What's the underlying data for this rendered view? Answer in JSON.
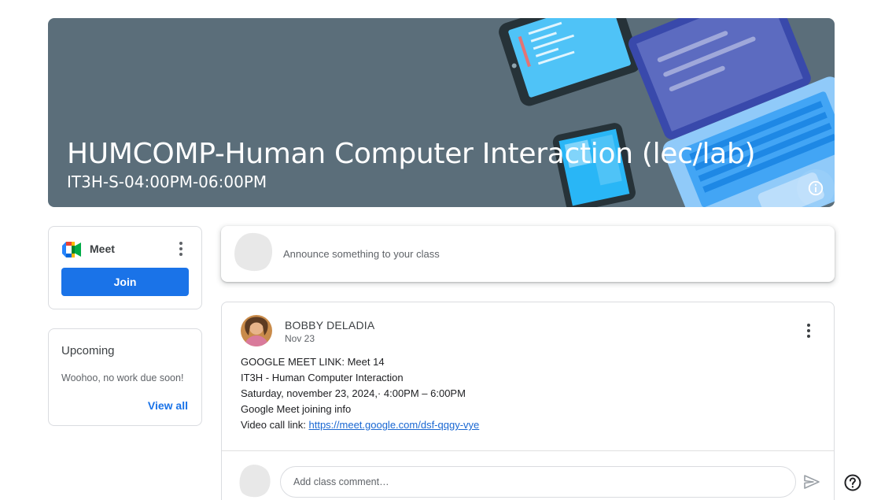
{
  "banner": {
    "title": "HUMCOMP-Human Computer Interaction (lec/lab)",
    "subtitle": "IT3H-S-04:00PM-06:00PM",
    "background_color": "#5b6e7a",
    "info_icon": "info-icon"
  },
  "meet": {
    "label": "Meet",
    "join_label": "Join",
    "logo_icon": "google-meet-icon",
    "menu_icon": "more-vert-icon",
    "accent": "#1a73e8"
  },
  "upcoming": {
    "title": "Upcoming",
    "empty_text": "Woohoo, no work due soon!",
    "view_all_label": "View all"
  },
  "announce": {
    "placeholder": "Announce something to your class"
  },
  "post": {
    "author": "BOBBY DELADIA",
    "date": "Nov 23",
    "lines": [
      "GOOGLE MEET LINK: Meet 14",
      "IT3H - Human Computer Interaction",
      "Saturday, november 23, 2024,· 4:00PM – 6:00PM",
      "Google Meet joining info"
    ],
    "video_prefix": "Video call link: ",
    "video_link": "https://meet.google.com/dsf-qqgy-vye",
    "comment_placeholder": "Add class comment…",
    "send_icon": "send-icon",
    "menu_icon": "more-vert-icon"
  },
  "help_icon": "help-icon"
}
